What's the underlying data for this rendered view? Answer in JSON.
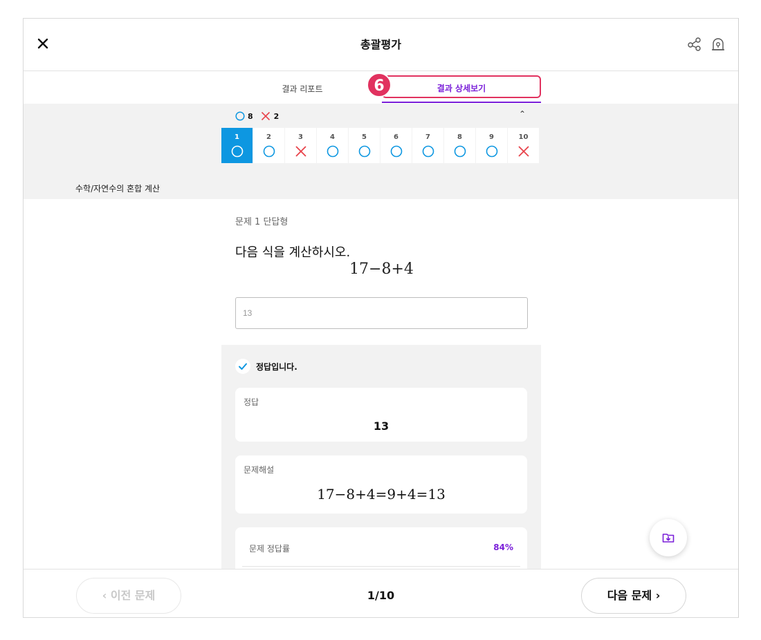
{
  "header": {
    "title": "총괄평가"
  },
  "tabs": {
    "report": "결과 리포트",
    "detail": "결과 상세보기",
    "step_badge": "6"
  },
  "summary": {
    "correct_count": "8",
    "wrong_count": "2"
  },
  "questions": [
    {
      "num": "1",
      "result": "correct",
      "active": true
    },
    {
      "num": "2",
      "result": "correct"
    },
    {
      "num": "3",
      "result": "wrong"
    },
    {
      "num": "4",
      "result": "correct"
    },
    {
      "num": "5",
      "result": "correct"
    },
    {
      "num": "6",
      "result": "correct"
    },
    {
      "num": "7",
      "result": "correct"
    },
    {
      "num": "8",
      "result": "correct"
    },
    {
      "num": "9",
      "result": "correct"
    },
    {
      "num": "10",
      "result": "wrong"
    }
  ],
  "category": "수학/자연수의 혼합 계산",
  "question": {
    "type": "문제 1 단답형",
    "text": "다음 식을 계산하시오.",
    "formula": "17−8+4",
    "input_value": "13"
  },
  "result": {
    "status": "정답입니다.",
    "answer_label": "정답",
    "answer_value": "13",
    "explain_label": "문제해설",
    "explain_formula": "17−8+4=9+4=13",
    "rate_label": "문제 정답률",
    "rate_value": "84%"
  },
  "footer": {
    "prev": "‹  이전 문제",
    "page": "1/10",
    "next": "다음 문제  ›"
  },
  "colors": {
    "accent": "#7a1fd9",
    "active": "#0d97e1",
    "correct": "#0d97e1",
    "wrong": "#e8424a",
    "badge": "#e1325f"
  }
}
